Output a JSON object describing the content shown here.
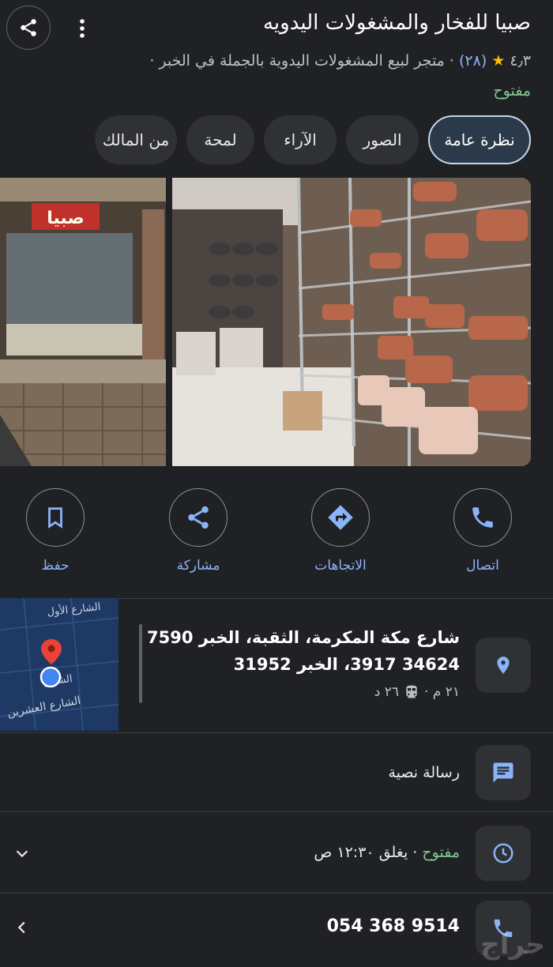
{
  "header": {
    "title": "صبيا للفخار والمشغولات اليدويه",
    "rating": "٤٫٣",
    "review_count": "(٢٨)",
    "category": "· متجر لبيع المشغولات اليدوية بالجملة في الخبر ·",
    "status": "مفتوح"
  },
  "tabs": [
    {
      "label": "نظرة عامة",
      "active": true
    },
    {
      "label": "الصور",
      "active": false
    },
    {
      "label": "الآراء",
      "active": false
    },
    {
      "label": "لمحة",
      "active": false
    },
    {
      "label": "من المالك",
      "active": false
    }
  ],
  "photos": {
    "left_sign": "صبيا"
  },
  "actions": [
    {
      "label": "اتصال",
      "icon": "phone-icon"
    },
    {
      "label": "الاتجاهات",
      "icon": "directions-icon"
    },
    {
      "label": "مشاركة",
      "icon": "share-icon"
    },
    {
      "label": "حفظ",
      "icon": "bookmark-icon"
    }
  ],
  "map": {
    "street_top": "الشارع الأول",
    "street_mid": "الشارع",
    "street_bottom": "الشارع العشرين"
  },
  "address": {
    "line1": "شارع مكة المكرمة، الثقبة، الخبر 7590",
    "line2": "34624 3917، الخبر 31952",
    "transit_left": "٢١ م ·",
    "transit_right": "٢٦ د"
  },
  "message": {
    "label": "رسالة نصية"
  },
  "hours": {
    "status": "مفتوح",
    "detail": "· يغلق ١٢:٣٠ ص"
  },
  "phone": {
    "number": "054 368 9514"
  },
  "watermark": "حراج",
  "colors": {
    "background": "#202124",
    "accent_blue": "#8ab4f8",
    "open_green": "#81c995",
    "star": "#fbbc04"
  }
}
